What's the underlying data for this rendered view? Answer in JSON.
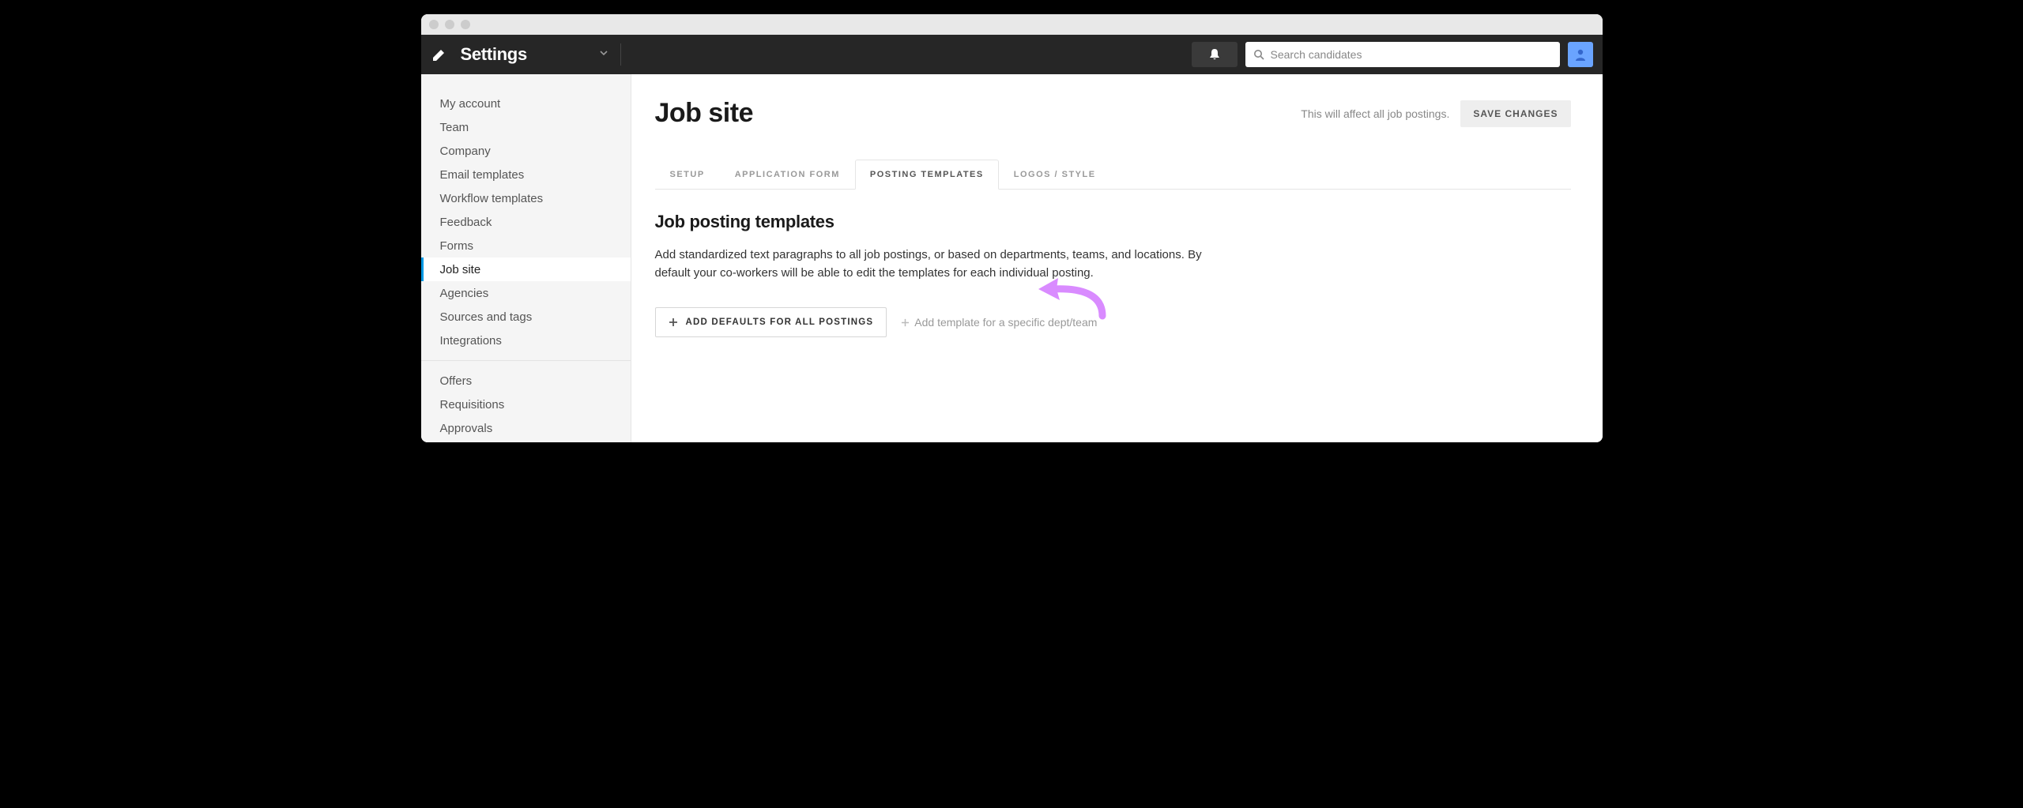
{
  "topbar": {
    "title": "Settings",
    "search_placeholder": "Search candidates"
  },
  "sidebar": {
    "group1": [
      "My account",
      "Team",
      "Company",
      "Email templates",
      "Workflow templates",
      "Feedback",
      "Forms",
      "Job site",
      "Agencies",
      "Sources and tags",
      "Integrations"
    ],
    "group2": [
      "Offers",
      "Requisitions",
      "Approvals"
    ],
    "active_index": 7
  },
  "page": {
    "title": "Job site",
    "note": "This will affect all job postings.",
    "save_label": "SAVE CHANGES"
  },
  "tabs": {
    "items": [
      "SETUP",
      "APPLICATION FORM",
      "POSTING TEMPLATES",
      "LOGOS / STYLE"
    ],
    "active_index": 2
  },
  "section": {
    "title": "Job posting templates",
    "description": "Add standardized text paragraphs to all job postings, or based on departments, teams, and locations. By default your co-workers will be able to edit the templates for each individual posting."
  },
  "actions": {
    "primary": "ADD DEFAULTS FOR ALL POSTINGS",
    "secondary": "Add template for a specific dept/team"
  },
  "annotation": {
    "arrow_color": "#d98bff"
  }
}
